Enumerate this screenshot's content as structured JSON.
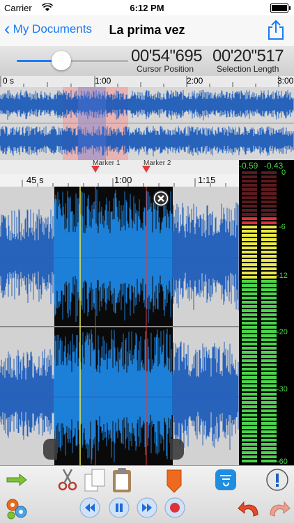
{
  "status_bar": {
    "carrier": "Carrier",
    "time": "6:12 PM"
  },
  "nav": {
    "back_label": "My Documents",
    "title": "La prima vez"
  },
  "info": {
    "cursor_position_value": "00'54\"695",
    "cursor_position_label": "Cursor Position",
    "selection_length_value": "00'20\"517",
    "selection_length_label": "Selection Length",
    "zoom_slider_fraction": 0.4
  },
  "overview_ruler": {
    "ticks": [
      "0 s",
      "1:00",
      "2:00",
      "3:00"
    ]
  },
  "markers": [
    {
      "label": "Marker 1"
    },
    {
      "label": "Marker 2"
    }
  ],
  "main_ruler": {
    "ticks": [
      "45 s",
      "1:00",
      "1:15"
    ]
  },
  "meters": {
    "peak_left": "-0.59",
    "peak_right": "-0.43",
    "scale": [
      "0",
      "-6",
      "-12",
      "-20",
      "-30",
      "-60"
    ]
  },
  "colors": {
    "accent": "#1a7cf5",
    "waveform": "#1456b8",
    "selection_wave": "#1e8df0",
    "meter_green": "#4cd34c",
    "meter_yellow": "#e8e84a",
    "meter_red": "#e0303a"
  },
  "toolbar": {
    "icons": [
      "arrow-right-icon",
      "scissors-icon",
      "copy-icon",
      "paste-icon",
      "marker-icon",
      "effects-icon",
      "info-icon",
      "settings-gears-icon",
      "rewind-icon",
      "pause-icon",
      "fast-forward-icon",
      "record-icon",
      "undo-icon",
      "redo-icon"
    ]
  }
}
